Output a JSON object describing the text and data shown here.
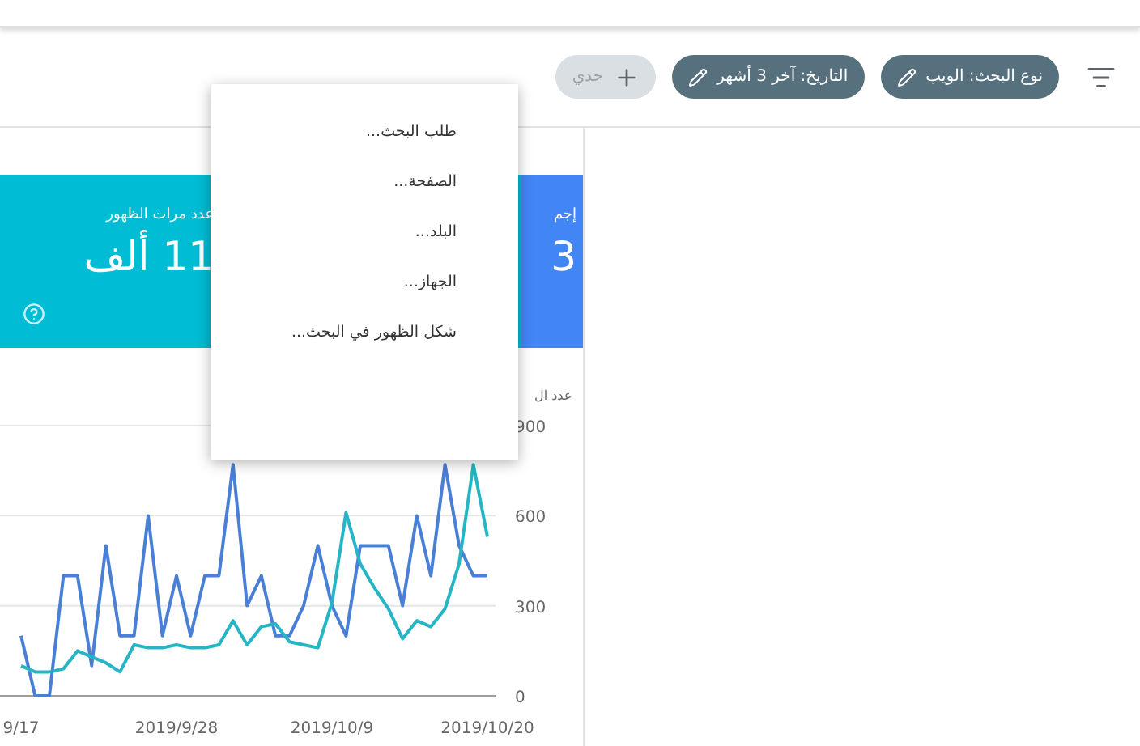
{
  "toolbar": {
    "chips": [
      {
        "kind": "filter",
        "label": "نوع البحث: الويب"
      },
      {
        "kind": "filter",
        "label": "التاريخ: آخر 3 أشهر"
      },
      {
        "kind": "add",
        "label": "جدي"
      }
    ]
  },
  "cards": [
    {
      "title": "إجم",
      "value": "3",
      "color": "#4285f4",
      "help": false
    },
    {
      "title": "عدد مرات الظهور",
      "value": "11 ألف",
      "color": "#00bcd4",
      "help": true
    }
  ],
  "chart": {
    "chart_data": {
      "type": "line",
      "ylabel": "عدد ال",
      "categories": [
        "9/17",
        null,
        null,
        null,
        null,
        null,
        null,
        null,
        null,
        null,
        null,
        "2019/9/28",
        null,
        null,
        null,
        null,
        null,
        null,
        null,
        null,
        null,
        null,
        "2019/10/9",
        null,
        null,
        null,
        null,
        null,
        null,
        null,
        null,
        null,
        null,
        "2019/10/20"
      ],
      "series": [
        {
          "color": "#4a7fd6",
          "values": [
            200,
            0,
            0,
            400,
            400,
            100,
            500,
            200,
            200,
            600,
            200,
            400,
            200,
            400,
            400,
            770,
            300,
            400,
            200,
            200,
            300,
            500,
            300,
            200,
            500,
            500,
            500,
            300,
            600,
            400,
            770,
            500,
            400,
            400
          ]
        },
        {
          "color": "#26b5c5",
          "values": [
            100,
            80,
            80,
            90,
            150,
            130,
            110,
            80,
            170,
            160,
            160,
            170,
            160,
            160,
            170,
            250,
            170,
            230,
            240,
            180,
            170,
            160,
            310,
            610,
            440,
            360,
            290,
            190,
            250,
            230,
            290,
            440,
            770,
            530
          ]
        }
      ],
      "ylim": [
        0,
        900
      ],
      "yticks": [
        0,
        300,
        600,
        900
      ]
    }
  },
  "menu": {
    "items": [
      "طلب البحث...",
      "الصفحة...",
      "البلد...",
      "الجهاز...",
      "شكل الظهور في البحث..."
    ]
  }
}
